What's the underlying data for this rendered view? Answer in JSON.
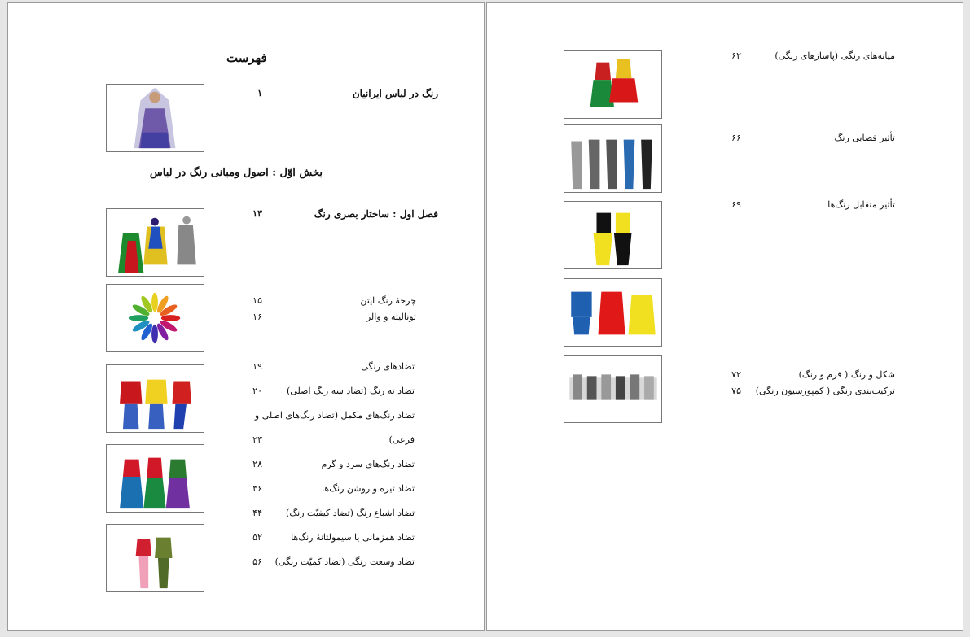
{
  "left_page": {
    "title": "فهرست",
    "intro": {
      "label": "رنگ در لباس ایرانیان",
      "page": "۱"
    },
    "part": "بخش اوّل : اصول ومبانی رنگ در لباس",
    "chapter": {
      "label": "فصل اول : ساختار بصری رنگ",
      "page": "۱۳"
    },
    "entries": [
      {
        "label": "چرخهٔ رنگ ایتن",
        "page": "۱۵"
      },
      {
        "label": "تونالیته و والر",
        "page": "۱۶"
      },
      {
        "label": "تضادهای رنگی",
        "page": "۱۹"
      },
      {
        "label": "تضاد ته رنگ (تضاد سه رنگ اصلی)",
        "page": "۲۰"
      },
      {
        "label": "تضاد رنگ‌های مکمل (تضاد رنگ‌های اصلی و",
        "page": ""
      },
      {
        "label": "فرعی)",
        "page": "۲۳"
      },
      {
        "label": "تضاد رنگ‌های سرد و گرم",
        "page": "۲۸"
      },
      {
        "label": "تضاد تیره و روشن رنگ‌ها",
        "page": "۳۶"
      },
      {
        "label": "تضاد اشباع رنگ (تضاد کیفیّت رنگ)",
        "page": "۴۴"
      },
      {
        "label": "تضاد همزمانی یا سیمولتانهٔ رنگ‌ها",
        "page": "۵۲"
      },
      {
        "label": "تضاد وسعت رنگی (تضاد کمیّت رنگی)",
        "page": "۵۶"
      }
    ]
  },
  "right_page": {
    "entries": [
      {
        "label": "میانه‌های رنگی (پاسازهای رنگی)",
        "page": "۶۲"
      },
      {
        "label": "تأثیر فضایی رنگ",
        "page": "۶۶"
      },
      {
        "label": "تأثیر متقابل رنگ‌ها",
        "page": "۶۹"
      },
      {
        "label": "شکل و رنگ ( فرم و رنگ)",
        "page": "۷۲"
      },
      {
        "label": "ترکیب‌بندی رنگی ( کمپوزسیون رنگی)",
        "page": "۷۵"
      }
    ]
  },
  "images": [
    {
      "name": "veiled-woman-figure"
    },
    {
      "name": "costume-figures-illustration"
    },
    {
      "name": "color-wheel-illustration"
    },
    {
      "name": "three-figures-primary-colors"
    },
    {
      "name": "three-figures-complementary"
    },
    {
      "name": "two-figures-illustration"
    },
    {
      "name": "two-dresses-green-red"
    },
    {
      "name": "five-figures-grey-blue"
    },
    {
      "name": "two-figures-yellow-black"
    },
    {
      "name": "three-dresses-blue-red-yellow"
    },
    {
      "name": "grey-clothing-group"
    }
  ]
}
